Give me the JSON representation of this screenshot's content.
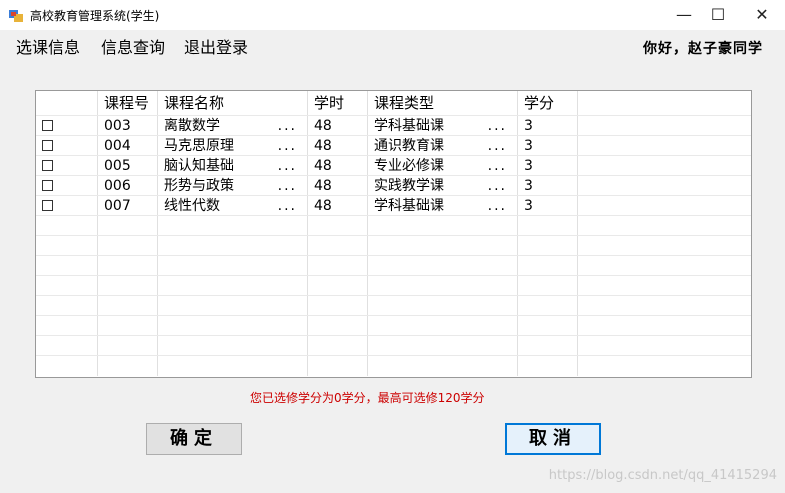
{
  "window": {
    "title": "高校教育管理系统(学生)",
    "min_glyph": "—",
    "max_glyph": "☐",
    "close_glyph": "✕",
    "app_icon": "window-app-icon"
  },
  "menu": [
    "选课信息",
    "信息查询",
    "退出登录"
  ],
  "greeting": "你好，赵子豪同学",
  "table": {
    "columns": [
      "",
      "课程号",
      "课程名称",
      "学时",
      "课程类型",
      "学分"
    ],
    "ellipsis": "...",
    "rows": [
      {
        "checked": false,
        "id": "003",
        "name": "离散数学",
        "hours": "48",
        "type": "学科基础课",
        "credit": "3"
      },
      {
        "checked": false,
        "id": "004",
        "name": "马克思原理",
        "hours": "48",
        "type": "通识教育课",
        "credit": "3"
      },
      {
        "checked": false,
        "id": "005",
        "name": "脑认知基础",
        "hours": "48",
        "type": "专业必修课",
        "credit": "3"
      },
      {
        "checked": false,
        "id": "006",
        "name": "形势与政策",
        "hours": "48",
        "type": "实践教学课",
        "credit": "3"
      },
      {
        "checked": false,
        "id": "007",
        "name": "线性代数",
        "hours": "48",
        "type": "学科基础课",
        "credit": "3"
      }
    ]
  },
  "note": "您已选修学分为0学分，最高可选修120学分",
  "buttons": {
    "ok": "确定",
    "cancel": "取消"
  },
  "watermark": "https://blog.csdn.net/qq_41415294",
  "colors": {
    "note": "#cc0000",
    "focus_border": "#0078d7"
  }
}
